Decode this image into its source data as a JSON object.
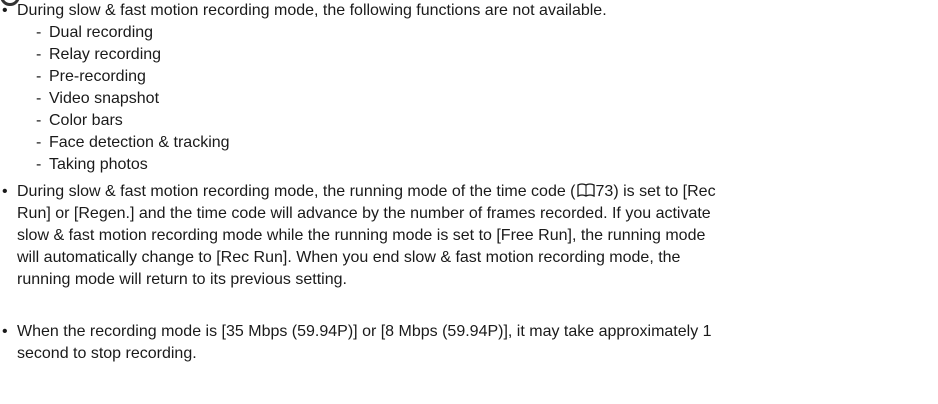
{
  "notes": {
    "bullet1": {
      "text": "During slow & fast motion recording mode, the following functions are not available.",
      "items": [
        "Dual recording",
        "Relay recording",
        "Pre-recording",
        "Video snapshot",
        "Color bars",
        "Face detection & tracking",
        "Taking photos"
      ]
    },
    "bullet2": {
      "lines": [
        [
          "During slow & fast motion recording mode, the running mode of the time code (",
          "73) is set to [Rec"
        ],
        "Run] or [Regen.] and the time code will advance by the number of frames recorded. If you activate",
        "slow & fast motion recording mode while the running mode is set to [Free Run], the running mode",
        "will automatically change to [Rec Run]. When you end slow & fast motion recording mode, the",
        "running mode will return to its previous setting."
      ]
    },
    "bullet3": {
      "lines": [
        "When the recording mode is [35 Mbps (59.94P)] or [8 Mbps (59.94P)], it may take approximately 1",
        "second to stop recording."
      ]
    }
  },
  "icons": {
    "page_reference": "book-icon"
  }
}
